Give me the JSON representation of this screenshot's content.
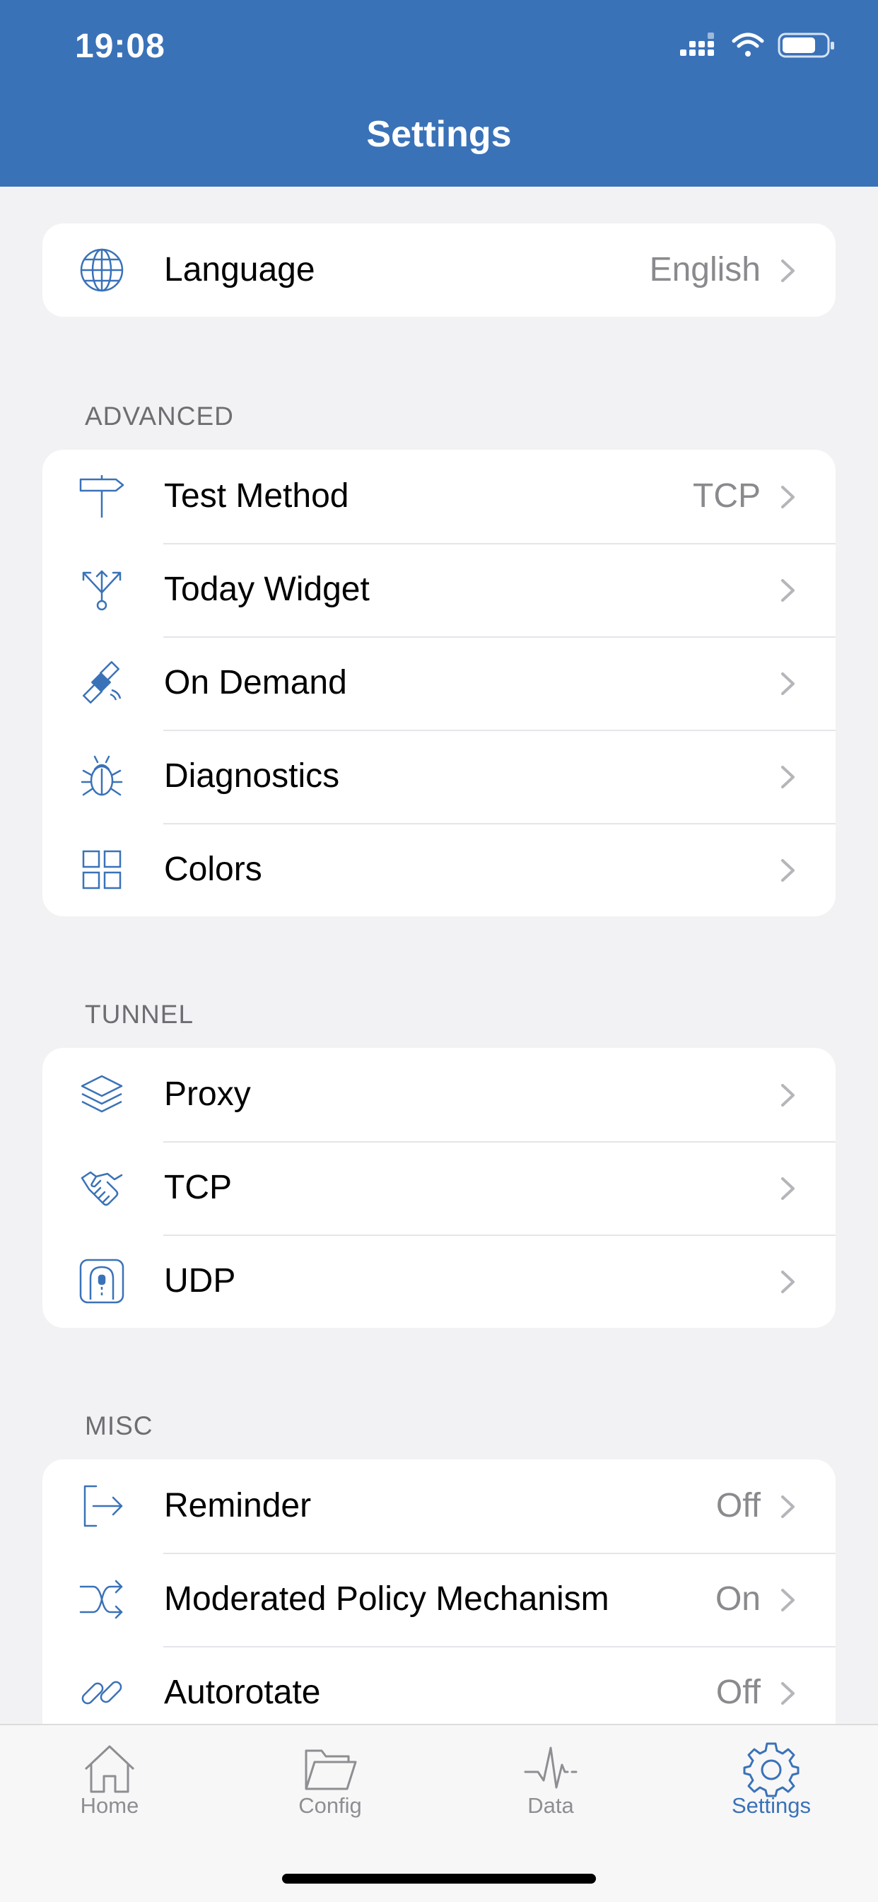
{
  "status_bar": {
    "time": "19:08"
  },
  "nav": {
    "title": "Settings"
  },
  "language": {
    "label": "Language",
    "value": "English",
    "icon": "globe-icon"
  },
  "advanced": {
    "header": "ADVANCED",
    "items": [
      {
        "label": "Test Method",
        "value": "TCP",
        "icon": "signpost-icon"
      },
      {
        "label": "Today Widget",
        "value": "",
        "icon": "branch-arrows-icon"
      },
      {
        "label": "On Demand",
        "value": "",
        "icon": "satellite-icon"
      },
      {
        "label": "Diagnostics",
        "value": "",
        "icon": "bug-icon"
      },
      {
        "label": "Colors",
        "value": "",
        "icon": "grid-icon"
      }
    ]
  },
  "tunnel": {
    "header": "TUNNEL",
    "items": [
      {
        "label": "Proxy",
        "value": "",
        "icon": "layers-icon"
      },
      {
        "label": "TCP",
        "value": "",
        "icon": "handshake-icon"
      },
      {
        "label": "UDP",
        "value": "",
        "icon": "tunnel-icon"
      }
    ]
  },
  "misc": {
    "header": "MISC",
    "items": [
      {
        "label": "Reminder",
        "value": "Off",
        "icon": "exit-arrow-icon"
      },
      {
        "label": "Moderated Policy Mechanism",
        "value": "On",
        "icon": "shuffle-icon"
      },
      {
        "label": "Autorotate",
        "value": "Off",
        "icon": "link-icon"
      }
    ]
  },
  "tabbar": {
    "items": [
      {
        "label": "Home",
        "icon": "home-icon",
        "active": false
      },
      {
        "label": "Config",
        "icon": "folder-icon",
        "active": false
      },
      {
        "label": "Data",
        "icon": "pulse-icon",
        "active": false
      },
      {
        "label": "Settings",
        "icon": "gear-icon",
        "active": true
      }
    ]
  },
  "colors": {
    "brand": "#3a72b8",
    "background": "#f2f2f4",
    "secondary_text": "#8a8a8e",
    "inactive_tab": "#8e8e93"
  }
}
